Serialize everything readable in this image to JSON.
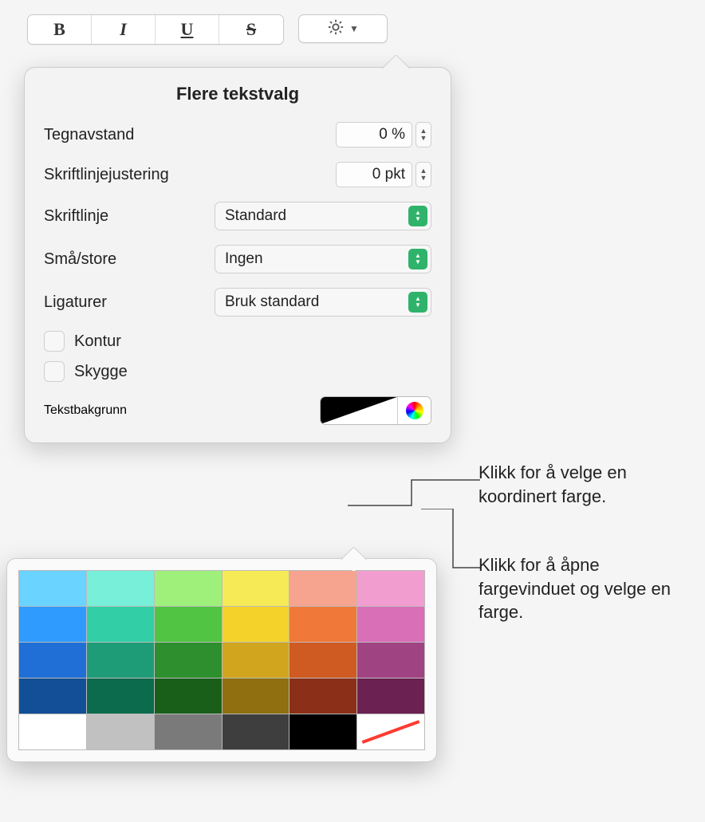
{
  "toolbar": {
    "bold": "B",
    "italic": "I",
    "underline": "U",
    "strike": "S"
  },
  "popover": {
    "title": "Flere tekstvalg",
    "charSpacingLabel": "Tegnavstand",
    "charSpacingValue": "0 %",
    "baselineLabel": "Skriftlinjejustering",
    "baselineValue": "0 pkt",
    "baselinePosLabel": "Skriftlinje",
    "baselinePosValue": "Standard",
    "capsLabel": "Små/store",
    "capsValue": "Ingen",
    "ligaturesLabel": "Ligaturer",
    "ligaturesValue": "Bruk standard",
    "outline": "Kontur",
    "shadow": "Skygge",
    "textBg": "Tekstbakgrunn"
  },
  "callouts": {
    "c1": "Klikk for å velge en koordinert farge.",
    "c2": "Klikk for å åpne fargevinduet og velge en farge."
  },
  "swatches": [
    "#6ad3ff",
    "#77efd9",
    "#9ff07a",
    "#f6ea56",
    "#f6a38f",
    "#f29dcf",
    "#2f9bff",
    "#32cfa6",
    "#52c443",
    "#f4d22a",
    "#f07838",
    "#d86fb7",
    "#1f6fd6",
    "#1e9c78",
    "#2e8f2e",
    "#d1a51d",
    "#cf5a22",
    "#a04383",
    "#134f96",
    "#0c6a4d",
    "#195f1a",
    "#8f6f0f",
    "#8b2f18",
    "#6b2152",
    "#ffffff",
    "#c1c1c1",
    "#7a7a7a",
    "#3e3e3e",
    "#000000",
    ""
  ]
}
